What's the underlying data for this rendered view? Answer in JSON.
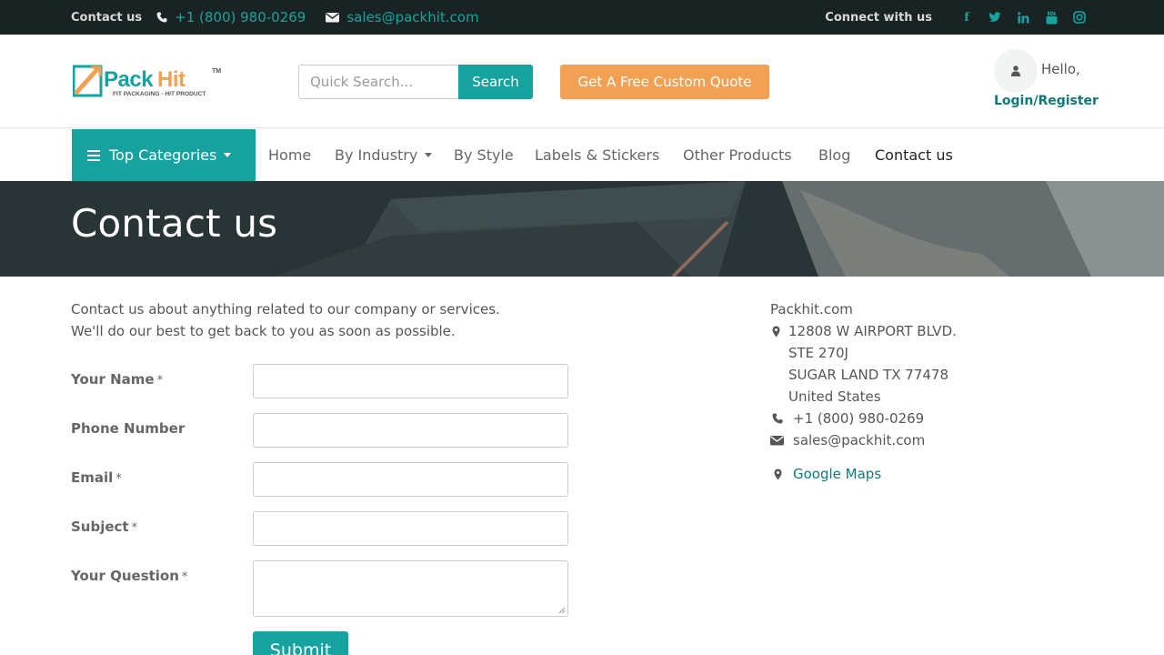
{
  "topbar": {
    "contact_label": "Contact us",
    "phone": "+1 (800) 980-0269",
    "email": "sales@packhit.com",
    "connect_label": "Connect with us",
    "social": [
      "facebook-icon",
      "twitter-icon",
      "linkedin-icon",
      "youtube-icon",
      "instagram-icon"
    ]
  },
  "header": {
    "logo_text": "PackHit",
    "logo_tagline": "FIT PACKAGING - HIT PRODUCT",
    "search_placeholder": "Quick Search...",
    "search_button": "Search",
    "quote_button": "Get A Free Custom Quote",
    "hello": "Hello,",
    "login": "Login/Register"
  },
  "nav": {
    "top_categories": "Top Categories",
    "items": [
      "Home",
      "By Industry",
      "By Style",
      "Labels & Stickers",
      "Other Products",
      "Blog",
      "Contact us"
    ]
  },
  "banner": {
    "title": "Contact us"
  },
  "intro": {
    "line1": "Contact us about anything related to our company or services.",
    "line2": "We'll do our best to get back to you as soon as possible."
  },
  "form": {
    "name_label": "Your Name",
    "phone_label": "Phone Number",
    "email_label": "Email",
    "subject_label": "Subject",
    "question_label": "Your Question",
    "required_mark": "*",
    "submit": "Submit"
  },
  "address": {
    "company": "Packhit.com",
    "street": "12808 W AIRPORT BLVD.",
    "suite": "STE 270J",
    "city": "SUGAR LAND TX 77478",
    "country": "United States",
    "phone": "+1 (800) 980-0269",
    "email": "sales@packhit.com",
    "maps": "Google Maps"
  },
  "colors": {
    "accent": "#16a3a0",
    "accent_dark": "#0e7a78",
    "orange": "#f2a154",
    "topbar": "#1a2323"
  }
}
